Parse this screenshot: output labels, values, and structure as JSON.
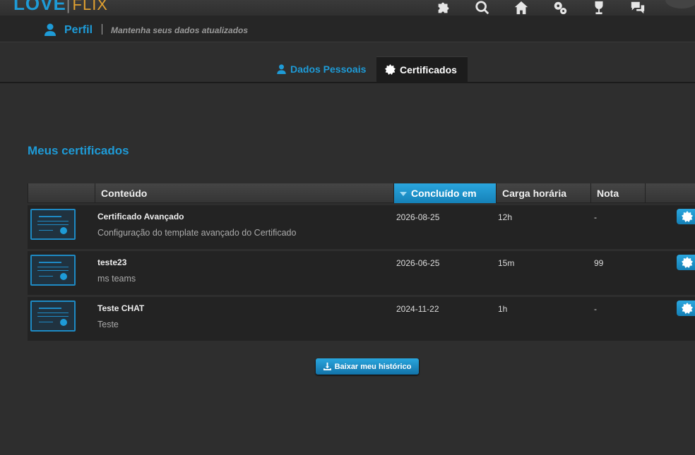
{
  "brand": {
    "logo_main": "LOVE",
    "logo_sep": "|",
    "logo_sub": "FLIX"
  },
  "topbar_icons": [
    "puzzle-icon",
    "search-icon",
    "home-icon",
    "gears-icon",
    "trophy-icon",
    "chat-icon"
  ],
  "header": {
    "title": "Perfil",
    "subtitle": "Mantenha seus dados atualizados"
  },
  "tabs": [
    {
      "label": "Dados Pessoais",
      "icon": "user-icon",
      "active": false
    },
    {
      "label": "Certificados",
      "icon": "certificate-icon",
      "active": true
    }
  ],
  "section_title": "Meus certificados",
  "table": {
    "columns": [
      "Conteúdo",
      "Concluído em",
      "Carga horária",
      "Nota"
    ],
    "sorted_column": "Concluído em",
    "rows": [
      {
        "title": "Certificado Avançado",
        "description": "Configuração do template avançado do Certificado",
        "completed": "2026-08-25",
        "workload": "12h",
        "grade": "-"
      },
      {
        "title": "teste23",
        "description": "ms teams",
        "completed": "2026-06-25",
        "workload": "15m",
        "grade": "99"
      },
      {
        "title": "Teste CHAT",
        "description": "Teste",
        "completed": "2024-11-22",
        "workload": "1h",
        "grade": "-"
      }
    ]
  },
  "download_button": "Baixar meu histórico",
  "colors": {
    "accent": "#1e9bd7",
    "background": "#2e2e2e",
    "row_bg": "#232323",
    "logo_sub": "#e0a030"
  }
}
